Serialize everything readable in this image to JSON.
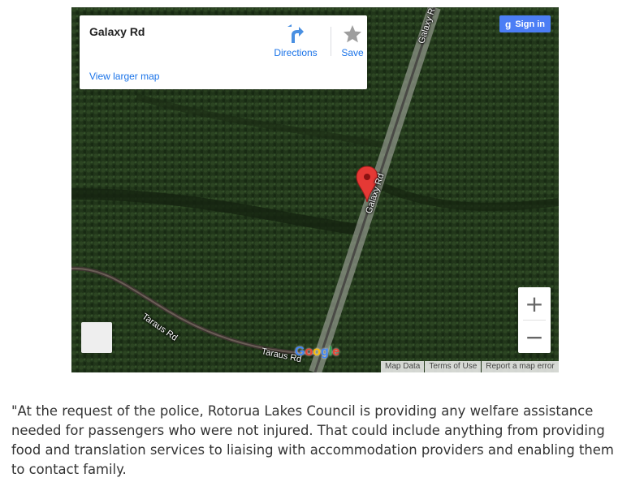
{
  "map": {
    "place_name": "Galaxy Rd",
    "view_larger_map": "View larger map",
    "directions_label": "Directions",
    "save_label": "Save",
    "sign_in_label": "Sign in",
    "sign_in_glyph": "g",
    "zoom_in": "+",
    "zoom_out": "−",
    "google_logo": [
      "G",
      "o",
      "o",
      "g",
      "l",
      "e"
    ],
    "logo_colors": [
      "#4285f4",
      "#ea4335",
      "#fbbc05",
      "#4285f4",
      "#34a853",
      "#ea4335"
    ],
    "roads": [
      {
        "label": "Galaxy R",
        "id": "galaxy-top"
      },
      {
        "label": "Galaxy Rd",
        "id": "galaxy-mid"
      },
      {
        "label": "Taraus Rd",
        "id": "taraus-left"
      },
      {
        "label": "Taraus Rd",
        "id": "taraus-bottom"
      }
    ],
    "attribution": {
      "map_data": "Map Data",
      "terms": "Terms of Use",
      "report": "Report a map error"
    },
    "colors": {
      "accent": "#1a73e8",
      "sign_in_bg": "#4c7ef5",
      "marker": "#e53935",
      "forest": "#1f3117"
    }
  },
  "article": {
    "paragraph": "\"At the request of the police, Rotorua Lakes Council is providing any welfare assistance needed for passengers who were not injured. That could include anything from providing food and translation services to liaising with accommodation providers and enabling them to contact family."
  }
}
